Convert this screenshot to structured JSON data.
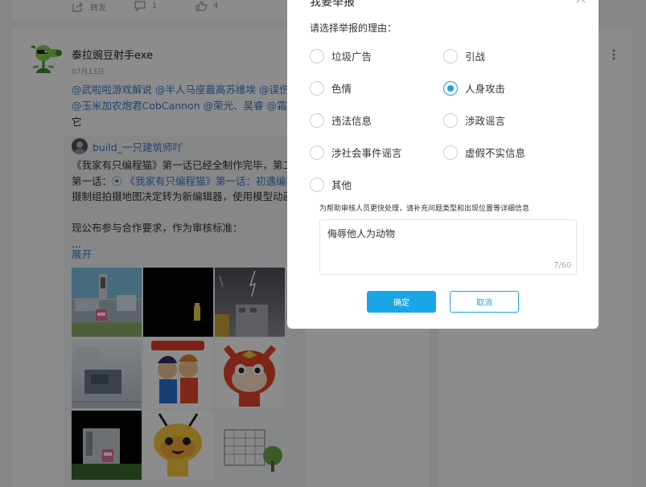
{
  "feed": {
    "prev_post_stats": {
      "repost_label": "转发",
      "comment_count": "1",
      "like_count": "4"
    },
    "post": {
      "username": "泰拉豌豆射手exe",
      "date": "07月13日",
      "content_line1": "@武啦啦游戏解说 @半人马座最高苏维埃 @误伤萌",
      "content_line2": "@玉米加农炮君CobCannon @荣光、吴睿 @霜星",
      "content_line3": "它",
      "repost": {
        "author": "build_一只建筑师吖",
        "line1": "《我家有只编程猫》第一话已经全制作完毕，第二话",
        "line2_prefix": "第一话：",
        "line2_link": "《我家有只编程猫》第一话：初遇编程",
        "line3": "摄制组拍摄地图决定转为新编辑器，使用模型动画来",
        "line4": "现公布参与合作要求，作为审核标准：",
        "line5": "...",
        "expand_label": "展开"
      }
    }
  },
  "report_dialog": {
    "title": "我要举报",
    "prompt": "请选择举报的理由：",
    "options": [
      {
        "label": "垃圾广告",
        "selected": false
      },
      {
        "label": "引战",
        "selected": false
      },
      {
        "label": "色情",
        "selected": false
      },
      {
        "label": "人身攻击",
        "selected": true
      },
      {
        "label": "违法信息",
        "selected": false
      },
      {
        "label": "涉政谣言",
        "selected": false
      },
      {
        "label": "涉社会事件谣言",
        "selected": false
      },
      {
        "label": "虚假不实信息",
        "selected": false
      },
      {
        "label": "其他",
        "selected": false
      }
    ],
    "hint": "为帮助审核人员更快处理，请补充问题类型和出现位置等详细信息",
    "detail_value": "侮辱他人为动物",
    "char_count": "7/60",
    "confirm_label": "确定",
    "cancel_label": "取消"
  },
  "colors": {
    "accent": "#1aa6e6",
    "link": "#3c7ccb",
    "overlay": "rgba(0,0,0,0.45)"
  }
}
